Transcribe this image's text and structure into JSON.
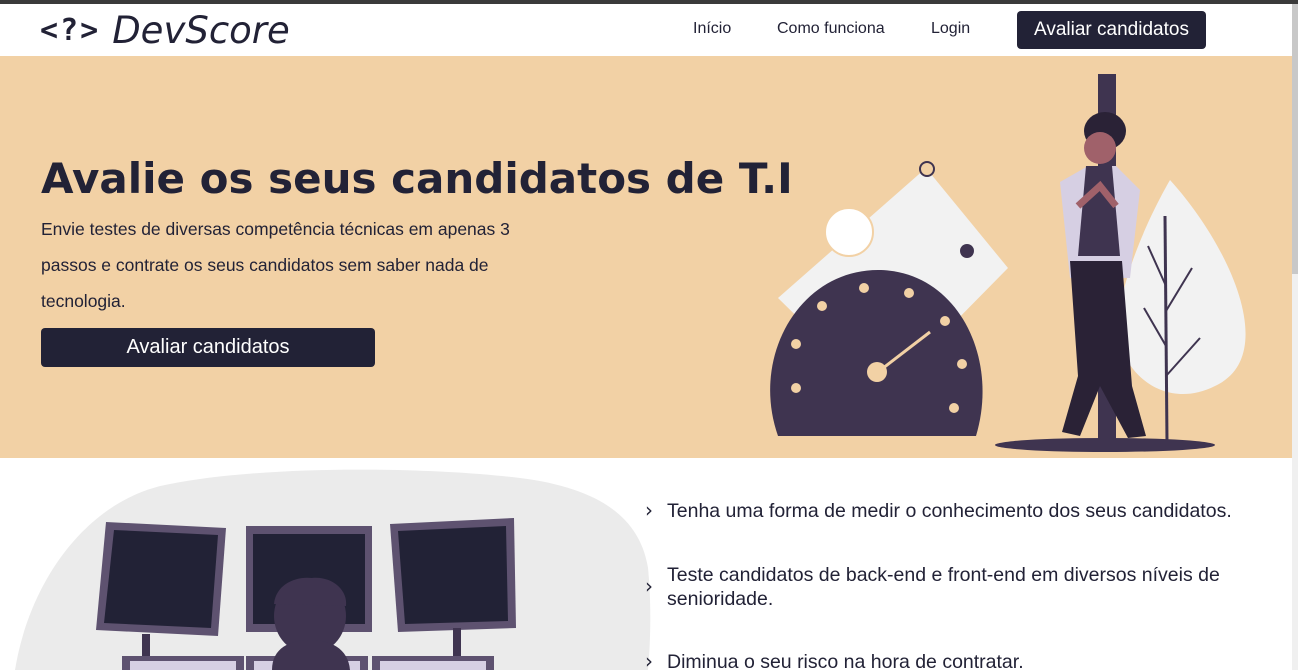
{
  "brand": {
    "mark": "<?>",
    "name": "DevScore"
  },
  "nav": {
    "links": [
      "Início",
      "Como funciona",
      "Login"
    ],
    "cta": "Avaliar candidatos"
  },
  "hero": {
    "title": "Avalie os seus candidatos de T.I",
    "lines": [
      "Envie testes de diversas competência técnicas em apenas 3",
      "passos e contrate os seus candidatos sem saber nada de",
      "tecnologia."
    ],
    "cta": "Avaliar candidatos"
  },
  "features": [
    {
      "icon": "chevron-right-icon",
      "lines": [
        "Tenha uma forma de medir o conhecimento dos seus candidatos."
      ]
    },
    {
      "icon": "chevron-right-icon",
      "lines": [
        "Teste candidatos de back-end e front-end em diversos níveis de",
        "senioridade."
      ]
    },
    {
      "icon": "chevron-right-icon",
      "lines": [
        "Diminua o seu risco na hora de contratar."
      ]
    }
  ],
  "colors": {
    "primary": "#222236",
    "hero_bg": "#f2d1a5",
    "illustration_dark": "#3f3450",
    "illustration_light": "#f2f2f2"
  }
}
